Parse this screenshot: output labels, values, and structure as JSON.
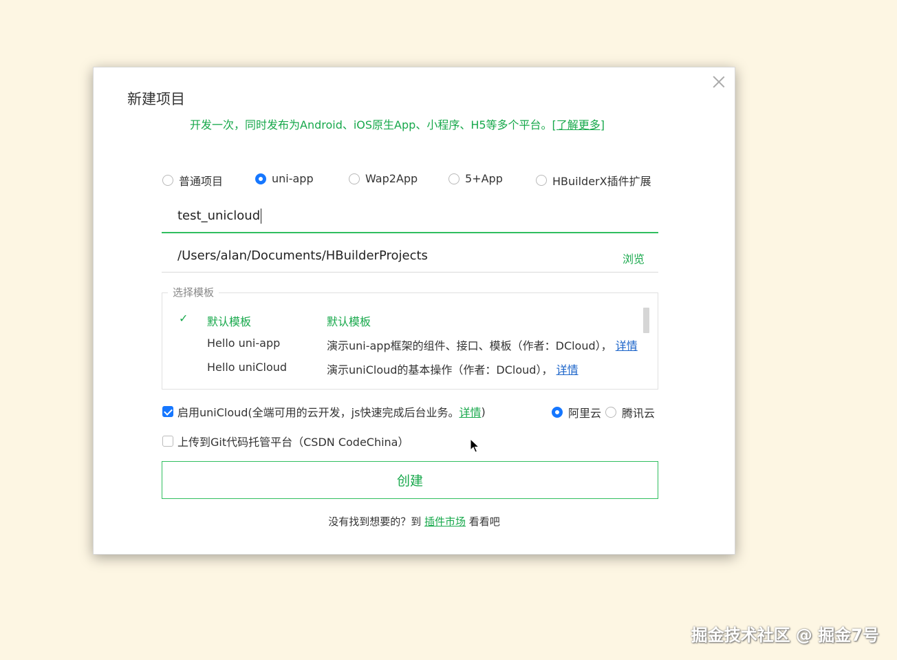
{
  "dialog": {
    "title": "新建项目",
    "subtitle": "开发一次，同时发布为Android、iOS原生App、小程序、H5等多个平台。",
    "learn_more": "[了解更多]",
    "close_icon": "close-icon"
  },
  "project_types": [
    {
      "label": "普通项目",
      "selected": false
    },
    {
      "label": "uni-app",
      "selected": true
    },
    {
      "label": "Wap2App",
      "selected": false
    },
    {
      "label": "5+App",
      "selected": false
    },
    {
      "label": "HBuilderX插件扩展",
      "selected": false
    }
  ],
  "project_name": {
    "value": "test_unicloud"
  },
  "project_path": {
    "value": "/Users/alan/Documents/HBuilderProjects",
    "browse_label": "浏览"
  },
  "templates": {
    "legend": "选择模板",
    "items": [
      {
        "name": "默认模板",
        "desc": "默认模板",
        "link": "",
        "selected": true
      },
      {
        "name": "Hello uni-app",
        "desc": "演示uni-app框架的组件、接口、模板（作者：DCloud），",
        "link": "详情",
        "selected": false
      },
      {
        "name": "Hello uniCloud",
        "desc": "演示uniCloud的基本操作（作者：DCloud），",
        "link": "详情",
        "selected": false
      }
    ]
  },
  "unicloud": {
    "checked": true,
    "label_before": "启用uniCloud(全端可用的云开发，js快速完成后台业务。",
    "link": "详情",
    "label_after": ")",
    "providers": [
      {
        "label": "阿里云",
        "selected": true
      },
      {
        "label": "腾讯云",
        "selected": false
      }
    ]
  },
  "git": {
    "checked": false,
    "label": "上传到Git代码托管平台（CSDN CodeChina）"
  },
  "create_button": "创建",
  "footer": {
    "before": "没有找到想要的？到",
    "link": "插件市场",
    "after": "看看吧"
  },
  "watermark": "掘金技术社区 @ 掘金7号",
  "colors": {
    "accent_green": "#17a84b",
    "radio_blue": "#1677ff",
    "link_blue": "#1a63c9",
    "background": "#fdf6e3"
  }
}
